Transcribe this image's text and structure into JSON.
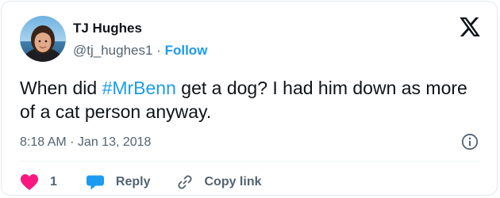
{
  "author": {
    "name": "TJ Hughes",
    "handle": "@tj_hughes1",
    "separator": "·",
    "follow_label": "Follow"
  },
  "tweet": {
    "text_before": "When did ",
    "hashtag": "#MrBenn",
    "text_after": " get a dog?  I had him down as more of a cat person anyway.",
    "timestamp": "8:18 AM · Jan 13, 2018"
  },
  "actions": {
    "like_count": "1",
    "reply_label": "Reply",
    "copy_link_label": "Copy link"
  },
  "icons": {
    "logo": "x-logo-icon",
    "info": "info-icon",
    "like": "heart-icon",
    "reply": "speech-bubble-icon",
    "copy": "link-icon"
  },
  "colors": {
    "accent": "#1d9bf0",
    "like": "#f91880",
    "text": "#0f1419",
    "muted": "#536471"
  }
}
